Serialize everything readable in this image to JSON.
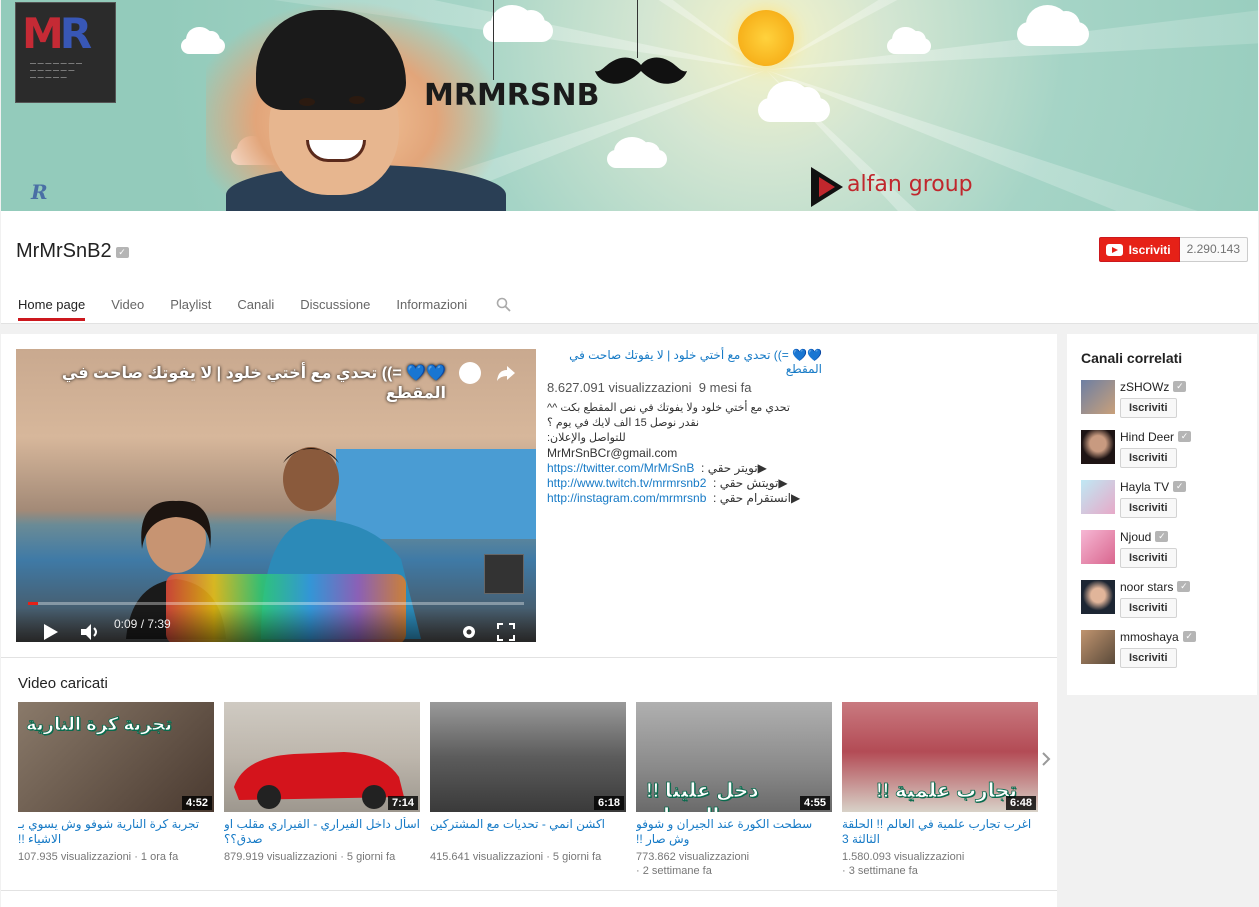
{
  "banner": {
    "brand_text": "MRMRSNB",
    "partner_logo": "alfan group",
    "avatar_letters": [
      "M",
      "R"
    ]
  },
  "channel": {
    "name": "MrMrSnB2",
    "subscribe_label": "Iscriviti",
    "subscriber_count": "2.290.143"
  },
  "tabs": [
    {
      "label": "Home page",
      "active": true
    },
    {
      "label": "Video"
    },
    {
      "label": "Playlist"
    },
    {
      "label": "Canali"
    },
    {
      "label": "Discussione"
    },
    {
      "label": "Informazioni"
    }
  ],
  "featured": {
    "player_title": "💙💙 =)) تحدي مع أختي خلود | لا يفوتك صاحت في المقطع",
    "time": "0:09 / 7:39",
    "progress_fraction": 0.02,
    "title": "💙💙 =)) تحدي مع أختي خلود | لا يفوتك صاحت في المقطع",
    "views": "8.627.091 visualizzazioni",
    "age": "9 mesi fa",
    "desc_lines": [
      "تحدي مع أختي خلود ولا يفوتك في نص المقطع بكت ^^",
      "نقدر نوصل 15 الف لايك في يوم ؟",
      "للتواصل والإعلان:",
      "MrMrSnBCr@gmail.com"
    ],
    "links": [
      {
        "prefix": "تويتر حقي : ",
        "url": "https://twitter.com/MrMrSnB",
        "icon": "▶"
      },
      {
        "prefix": "تويتش حقي : ",
        "url": "http://www.twitch.tv/mrmrsnb2",
        "icon": "▶"
      },
      {
        "prefix": "انستقرام حقي : ",
        "url": "http://instagram.com/mrmrsnb",
        "icon": "▶"
      }
    ]
  },
  "uploads": {
    "section_title": "Video caricati",
    "items": [
      {
        "title": "تجربة كرة النارية شوفو وش يسوي بـ الاشياء !!",
        "duration": "4:52",
        "views": "107.935 visualizzazioni",
        "age": "1 ora fa",
        "overlay": "تجربة كرة النارية",
        "color": "#6b5a4a"
      },
      {
        "title": "اسأل داخل الفيراري - الفيراري مقلب او صدق؟؟",
        "duration": "7:14",
        "views": "879.919 visualizzazioni",
        "age": "5 giorni fa",
        "overlay": "",
        "color": "#b8b3aa"
      },
      {
        "title": "اكشن انمي - تحديات مع المشتركين",
        "duration": "6:18",
        "views": "415.641 visualizzazioni",
        "age": "5 giorni fa",
        "overlay": "",
        "color": "#6c6c6c"
      },
      {
        "title": "سطحت الكورة عند الجيران و شوفو وش صار !!",
        "duration": "4:55",
        "views": "773.862 visualizzazioni",
        "age": "2 settimane fa",
        "overlay": "!! دخل علينا الجيران",
        "color": "#8f8f8f"
      },
      {
        "title": "اغرب تجارب علمية في العالم !! الحلقة الثالثة 3",
        "duration": "6:48",
        "views": "1.580.093 visualizzazioni",
        "age": "3 settimane fa",
        "overlay": "!! تجارب علمية",
        "color": "#b34b55"
      }
    ]
  },
  "sidebar": {
    "title": "Canali correlati",
    "button_label": "Iscriviti",
    "channels": [
      {
        "name": "zSHOWz",
        "color": "#6d7fa3"
      },
      {
        "name": "Hind Deer",
        "color": "#3a2a2a"
      },
      {
        "name": "Hayla TV",
        "color": "#8fd3e6"
      },
      {
        "name": "Njoud",
        "color": "#e88bb8"
      },
      {
        "name": "noor stars",
        "color": "#2d3a4a"
      },
      {
        "name": "mmoshaya",
        "color": "#b07a5a"
      }
    ]
  },
  "colors": {
    "accent_red": "#e62117",
    "link_blue": "#167ac6"
  }
}
